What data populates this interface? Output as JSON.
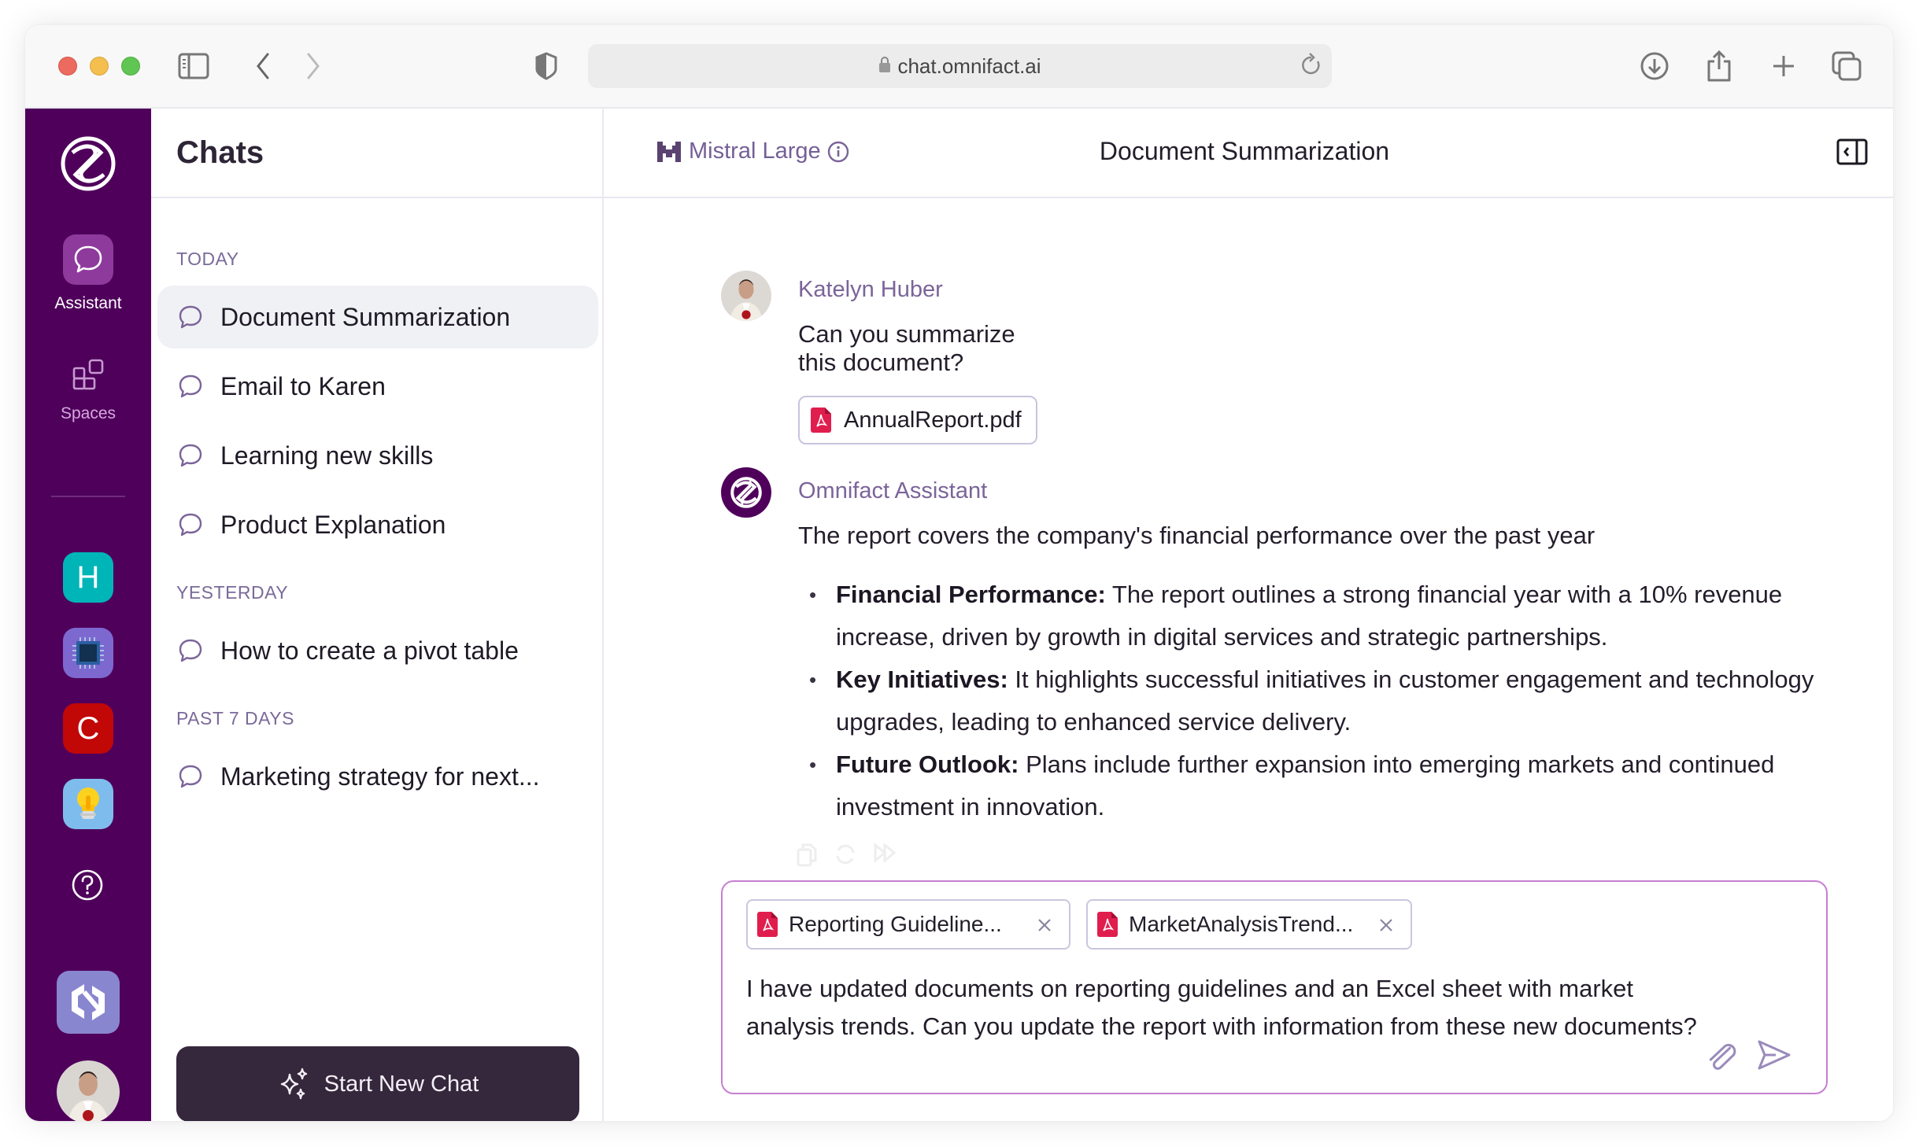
{
  "browser": {
    "url": "chat.omnifact.ai",
    "buttons": [
      "sidebar-toggle",
      "back",
      "forward",
      "privacy-shield",
      "downloads",
      "share",
      "new-tab",
      "tab-overview"
    ]
  },
  "rail": {
    "items": [
      {
        "label": "Assistant",
        "icon": "chat-bubble-icon",
        "active": true
      },
      {
        "label": "Spaces",
        "icon": "spaces-grid-icon",
        "active": false
      }
    ],
    "spaces": [
      {
        "letter": "H",
        "color": "#00b5b8"
      },
      {
        "letter": "",
        "icon": "chip-icon",
        "color": "#7d68d0"
      },
      {
        "letter": "C",
        "color": "#c20707"
      },
      {
        "letter": "",
        "icon": "lightbulb-icon",
        "color": "#7fbcee"
      }
    ],
    "colors": {
      "background": "#4f005b",
      "active_tile": "#8e3a9d"
    }
  },
  "chatlist": {
    "title": "Chats",
    "sections": [
      {
        "label": "TODAY",
        "items": [
          "Document Summarization",
          "Email to Karen",
          "Learning new skills",
          "Product Explanation"
        ]
      },
      {
        "label": "YESTERDAY",
        "items": [
          "How to create a pivot table"
        ]
      },
      {
        "label": "PAST 7 DAYS",
        "items": [
          "Marketing strategy for next..."
        ]
      }
    ],
    "active_item": "Document Summarization",
    "new_chat_label": "Start New Chat"
  },
  "main": {
    "model_name": "Mistral Large",
    "chat_title": "Document Summarization",
    "messages": [
      {
        "author": "Katelyn Huber",
        "text": "Can you summarize this document?",
        "attachment": "AnnualReport.pdf"
      },
      {
        "author": "Omnifact Assistant",
        "intro": "The report covers the company's financial performance over the past year",
        "bullets": [
          {
            "title": "Financial Performance:",
            "text": " The report outlines a strong financial year with a 10% revenue increase, driven by growth in digital services and strategic partnerships."
          },
          {
            "title": "Key Initiatives:",
            "text": " It highlights successful initiatives in customer engagement and technology upgrades, leading to enhanced service delivery."
          },
          {
            "title": "Future Outlook:",
            "text": " Plans include further expansion into emerging markets and continued investment in innovation."
          }
        ]
      }
    ],
    "composer": {
      "attachments": [
        "Reporting Guideline...",
        "MarketAnalysisTrend..."
      ],
      "text": "I have updated documents on reporting guidelines and an Excel sheet with market analysis trends. Can you update the report with information from these new documents?"
    }
  }
}
